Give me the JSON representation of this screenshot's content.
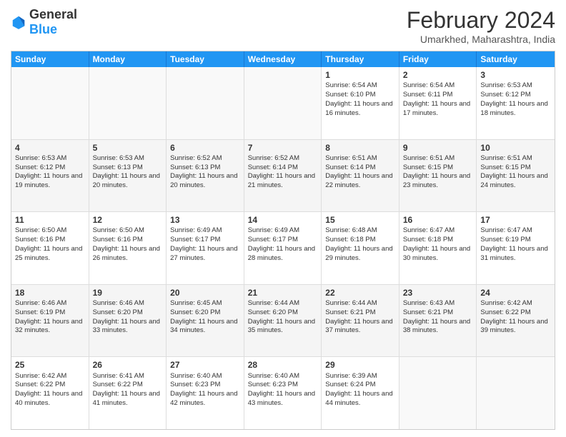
{
  "header": {
    "logo_general": "General",
    "logo_blue": "Blue",
    "title": "February 2024",
    "subtitle": "Umarkhed, Maharashtra, India"
  },
  "days_of_week": [
    "Sunday",
    "Monday",
    "Tuesday",
    "Wednesday",
    "Thursday",
    "Friday",
    "Saturday"
  ],
  "weeks": [
    {
      "cells": [
        {
          "empty": true
        },
        {
          "empty": true
        },
        {
          "empty": true
        },
        {
          "empty": true
        },
        {
          "day": 1,
          "sunrise": "6:54 AM",
          "sunset": "6:10 PM",
          "daylight": "11 hours and 16 minutes."
        },
        {
          "day": 2,
          "sunrise": "6:54 AM",
          "sunset": "6:11 PM",
          "daylight": "11 hours and 17 minutes."
        },
        {
          "day": 3,
          "sunrise": "6:53 AM",
          "sunset": "6:12 PM",
          "daylight": "11 hours and 18 minutes."
        }
      ]
    },
    {
      "cells": [
        {
          "day": 4,
          "sunrise": "6:53 AM",
          "sunset": "6:12 PM",
          "daylight": "11 hours and 19 minutes."
        },
        {
          "day": 5,
          "sunrise": "6:53 AM",
          "sunset": "6:13 PM",
          "daylight": "11 hours and 20 minutes."
        },
        {
          "day": 6,
          "sunrise": "6:52 AM",
          "sunset": "6:13 PM",
          "daylight": "11 hours and 20 minutes."
        },
        {
          "day": 7,
          "sunrise": "6:52 AM",
          "sunset": "6:14 PM",
          "daylight": "11 hours and 21 minutes."
        },
        {
          "day": 8,
          "sunrise": "6:51 AM",
          "sunset": "6:14 PM",
          "daylight": "11 hours and 22 minutes."
        },
        {
          "day": 9,
          "sunrise": "6:51 AM",
          "sunset": "6:15 PM",
          "daylight": "11 hours and 23 minutes."
        },
        {
          "day": 10,
          "sunrise": "6:51 AM",
          "sunset": "6:15 PM",
          "daylight": "11 hours and 24 minutes."
        }
      ]
    },
    {
      "cells": [
        {
          "day": 11,
          "sunrise": "6:50 AM",
          "sunset": "6:16 PM",
          "daylight": "11 hours and 25 minutes."
        },
        {
          "day": 12,
          "sunrise": "6:50 AM",
          "sunset": "6:16 PM",
          "daylight": "11 hours and 26 minutes."
        },
        {
          "day": 13,
          "sunrise": "6:49 AM",
          "sunset": "6:17 PM",
          "daylight": "11 hours and 27 minutes."
        },
        {
          "day": 14,
          "sunrise": "6:49 AM",
          "sunset": "6:17 PM",
          "daylight": "11 hours and 28 minutes."
        },
        {
          "day": 15,
          "sunrise": "6:48 AM",
          "sunset": "6:18 PM",
          "daylight": "11 hours and 29 minutes."
        },
        {
          "day": 16,
          "sunrise": "6:47 AM",
          "sunset": "6:18 PM",
          "daylight": "11 hours and 30 minutes."
        },
        {
          "day": 17,
          "sunrise": "6:47 AM",
          "sunset": "6:19 PM",
          "daylight": "11 hours and 31 minutes."
        }
      ]
    },
    {
      "cells": [
        {
          "day": 18,
          "sunrise": "6:46 AM",
          "sunset": "6:19 PM",
          "daylight": "11 hours and 32 minutes."
        },
        {
          "day": 19,
          "sunrise": "6:46 AM",
          "sunset": "6:20 PM",
          "daylight": "11 hours and 33 minutes."
        },
        {
          "day": 20,
          "sunrise": "6:45 AM",
          "sunset": "6:20 PM",
          "daylight": "11 hours and 34 minutes."
        },
        {
          "day": 21,
          "sunrise": "6:44 AM",
          "sunset": "6:20 PM",
          "daylight": "11 hours and 35 minutes."
        },
        {
          "day": 22,
          "sunrise": "6:44 AM",
          "sunset": "6:21 PM",
          "daylight": "11 hours and 37 minutes."
        },
        {
          "day": 23,
          "sunrise": "6:43 AM",
          "sunset": "6:21 PM",
          "daylight": "11 hours and 38 minutes."
        },
        {
          "day": 24,
          "sunrise": "6:42 AM",
          "sunset": "6:22 PM",
          "daylight": "11 hours and 39 minutes."
        }
      ]
    },
    {
      "cells": [
        {
          "day": 25,
          "sunrise": "6:42 AM",
          "sunset": "6:22 PM",
          "daylight": "11 hours and 40 minutes."
        },
        {
          "day": 26,
          "sunrise": "6:41 AM",
          "sunset": "6:22 PM",
          "daylight": "11 hours and 41 minutes."
        },
        {
          "day": 27,
          "sunrise": "6:40 AM",
          "sunset": "6:23 PM",
          "daylight": "11 hours and 42 minutes."
        },
        {
          "day": 28,
          "sunrise": "6:40 AM",
          "sunset": "6:23 PM",
          "daylight": "11 hours and 43 minutes."
        },
        {
          "day": 29,
          "sunrise": "6:39 AM",
          "sunset": "6:24 PM",
          "daylight": "11 hours and 44 minutes."
        },
        {
          "empty": true
        },
        {
          "empty": true
        }
      ]
    }
  ]
}
